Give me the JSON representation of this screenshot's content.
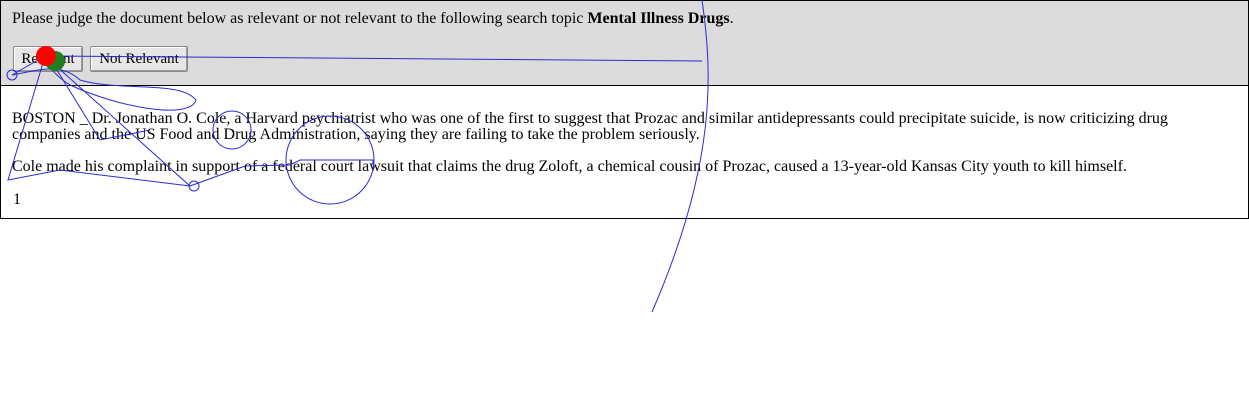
{
  "judgement": {
    "prompt_prefix": "Please judge the document below as relevant or not relevant to the following search topic",
    "topic": "Mental Illness Drugs",
    "prompt_suffix": ".",
    "relevant_label": "Relevant",
    "not_relevant_label": "Not Relevant"
  },
  "document": {
    "paragraphs": [
      "BOSTON _ Dr. Jonathan O. Cole, a Harvard psychiatrist who was one of the first to suggest that Prozac and similar antidepressants could precipitate suicide, is now criticizing drug companies and the US Food and Drug Administration, saying they are failing to take the problem seriously.",
      "Cole made his complaint in support of a federal court lawsuit that claims the drug Zoloft, a chemical cousin of Prozac, caused a 13-year-old Kansas City youth to kill himself."
    ],
    "page_number": "1"
  },
  "overlay_colors": {
    "trace": "#2a2ad6",
    "start_marker": "#1f7f1f",
    "end_marker": "#ff0000"
  }
}
